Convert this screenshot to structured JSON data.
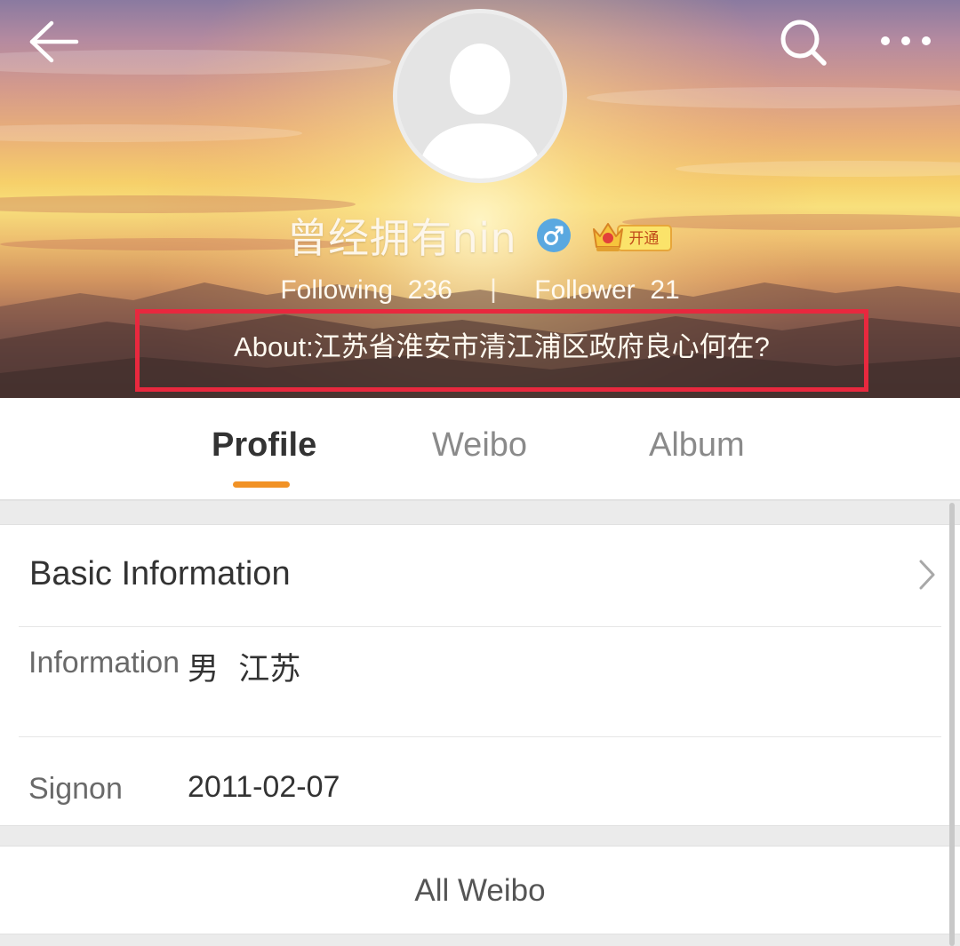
{
  "header": {
    "back_icon": "arrow-left-icon",
    "search_icon": "search-icon",
    "more_icon": "more-dots-icon",
    "username": "曾经拥有nin",
    "gender_icon": "male-icon",
    "gender_color": "#5aa8e0",
    "vip_label": "开通",
    "following_label": "Following",
    "following_count": "236",
    "separator": "|",
    "follower_label": "Follower",
    "follower_count": "21",
    "about": "About:江苏省淮安市清江浦区政府良心何在?",
    "highlight_color": "#e8283e"
  },
  "tabs": {
    "items": [
      {
        "label": "Profile",
        "active": true
      },
      {
        "label": "Weibo",
        "active": false
      },
      {
        "label": "Album",
        "active": false
      }
    ],
    "indicator_color": "#f19226"
  },
  "basic_info": {
    "title": "Basic Information",
    "rows": [
      {
        "key": "Information",
        "value": "男  江苏"
      },
      {
        "key": "Signon",
        "value": "2011-02-07"
      }
    ]
  },
  "all_weibo": {
    "label": "All Weibo"
  }
}
